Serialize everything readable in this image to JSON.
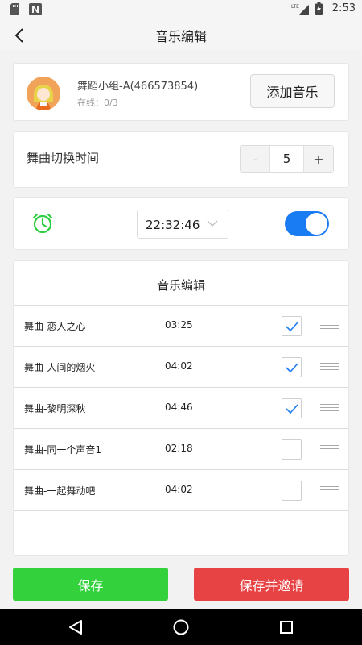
{
  "status_bar": {
    "time": "2:53",
    "network": "LTE",
    "icons": [
      "sd-card-icon",
      "n-notification-icon",
      "lte-signal-icon",
      "battery-charging-icon"
    ]
  },
  "app_bar": {
    "title": "音乐编辑",
    "back_icon": "chevron-left-icon"
  },
  "group": {
    "name": "舞蹈小组-A(466573854)",
    "online_text": "在线：0/3",
    "add_music_label": "添加音乐"
  },
  "interval": {
    "label": "舞曲切换时间",
    "minus": "-",
    "value": "5",
    "plus": "+"
  },
  "timer": {
    "icon": "alarm-clock-icon",
    "time": "22:32:46",
    "enabled": true,
    "accent_color": "#1a7cf2",
    "icon_color": "#2ecc40"
  },
  "playlist": {
    "title": "音乐编辑",
    "songs": [
      {
        "name": "舞曲-恋人之心",
        "duration": "03:25",
        "checked": true
      },
      {
        "name": "舞曲-人间的烟火",
        "duration": "04:02",
        "checked": true
      },
      {
        "name": "舞曲-黎明深秋",
        "duration": "04:46",
        "checked": true
      },
      {
        "name": "舞曲-同一个声音1",
        "duration": "02:18",
        "checked": false
      },
      {
        "name": "舞曲-一起舞动吧",
        "duration": "04:02",
        "checked": false
      }
    ]
  },
  "actions": {
    "save_label": "保存",
    "save_invite_label": "保存并邀请",
    "save_color": "#33d23d",
    "invite_color": "#e84344"
  },
  "nav_bar": {
    "icons": [
      "back-triangle-icon",
      "home-circle-icon",
      "recents-square-icon"
    ]
  }
}
